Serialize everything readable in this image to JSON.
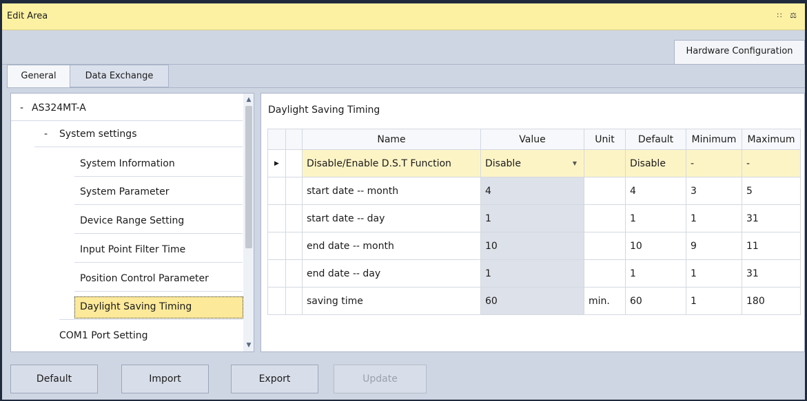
{
  "window": {
    "title": "Edit Area",
    "title_icons": "∷ ⚖"
  },
  "top_tab": {
    "label": "Hardware Configuration"
  },
  "sub_tabs": [
    {
      "label": "General"
    },
    {
      "label": "Data Exchange"
    }
  ],
  "tree": {
    "items": [
      {
        "toggle": "-",
        "label": "AS324MT-A"
      },
      {
        "toggle": "-",
        "label": "System settings"
      },
      {
        "label": "System Information"
      },
      {
        "label": "System Parameter"
      },
      {
        "label": "Device Range Setting"
      },
      {
        "label": "Input Point Filter Time"
      },
      {
        "label": "Position Control Parameter"
      },
      {
        "label": "Daylight Saving Timing"
      },
      {
        "label": "COM1 Port Setting"
      }
    ],
    "selected": "Daylight Saving Timing",
    "scroll_up": "▲",
    "scroll_down": "▼"
  },
  "panel": {
    "title": "Daylight Saving Timing",
    "columns": [
      "Name",
      "Value",
      "Unit",
      "Default",
      "Minimum",
      "Maximum"
    ],
    "current_row_marker": "▶",
    "rows": [
      {
        "name": "Disable/Enable D.S.T Function",
        "value": "Disable",
        "unit": "",
        "default": "Disable",
        "minimum": "-",
        "maximum": "-"
      },
      {
        "name": "start date -- month",
        "value": "4",
        "unit": "",
        "default": "4",
        "minimum": "3",
        "maximum": "5"
      },
      {
        "name": "start date -- day",
        "value": "1",
        "unit": "",
        "default": "1",
        "minimum": "1",
        "maximum": "31"
      },
      {
        "name": "end date -- month",
        "value": "10",
        "unit": "",
        "default": "10",
        "minimum": "9",
        "maximum": "11"
      },
      {
        "name": "end date -- day",
        "value": "1",
        "unit": "",
        "default": "1",
        "minimum": "1",
        "maximum": "31"
      },
      {
        "name": "saving time",
        "value": "60",
        "unit": "min.",
        "default": "60",
        "minimum": "1",
        "maximum": "180"
      }
    ],
    "dropdown_arrow": "▼"
  },
  "buttons": {
    "default": "Default",
    "import": "Import",
    "export": "Export",
    "update": "Update"
  },
  "colors": {
    "title_bar": "#fcf1a3",
    "selection": "#fce99a",
    "current_row": "#fdf4c6",
    "value_cell": "#dde1e9"
  }
}
